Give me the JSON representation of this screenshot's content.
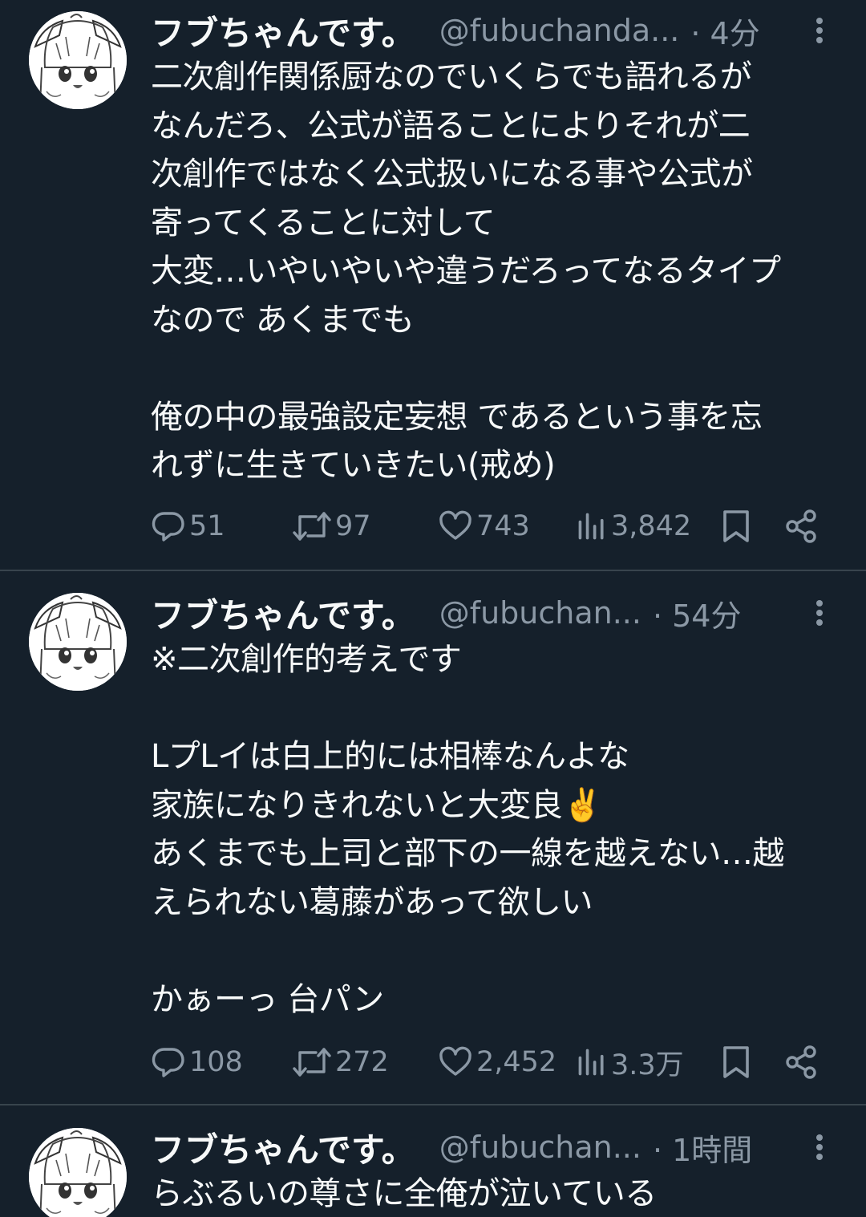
{
  "tweets": [
    {
      "display_name": "フブちゃんです。",
      "handle": "@fubuchanda...",
      "time": "· 4分",
      "text": "二次創作関係厨なのでいくらでも語れるが\nなんだろ、公式が語ることによりそれが二\n次創作ではなく公式扱いになる事や公式が\n寄ってくることに対して\n大変…いやいやいや違うだろってなるタイプ\nなので あくまでも\n\n俺の中の最強設定妄想 であるという事を忘\nれずに生きていきたい(戒め)",
      "replies": "51",
      "retweets": "97",
      "likes": "743",
      "views": "3,842"
    },
    {
      "display_name": "フブちゃんです。",
      "handle": "@fubuchan...",
      "time": "· 54分",
      "text": "※二次創作的考えです\n\nLプLイは白上的には相棒なんよな\n家族になりきれないと大変良✌️\nあくまでも上司と部下の一線を越えない…越\nえられない葛藤があって欲しい\n\nかぁーっ 台パン",
      "replies": "108",
      "retweets": "272",
      "likes": "2,452",
      "views": "3.3万"
    },
    {
      "display_name": "フブちゃんです。",
      "handle": "@fubuchan...",
      "time": "· 1時間",
      "text": "らぶるいの尊さに全俺が泣いている"
    }
  ],
  "icons": {
    "more": "more-vertical-icon",
    "reply": "reply-bubble-icon",
    "retweet": "retweet-icon",
    "like": "heart-icon",
    "views": "views-bar-chart-icon",
    "bookmark": "bookmark-icon",
    "share": "share-icon"
  },
  "colors": {
    "background": "#15202b",
    "divider": "#38444d",
    "text_primary": "#f7f9f9",
    "text_secondary": "#8b98a5"
  }
}
